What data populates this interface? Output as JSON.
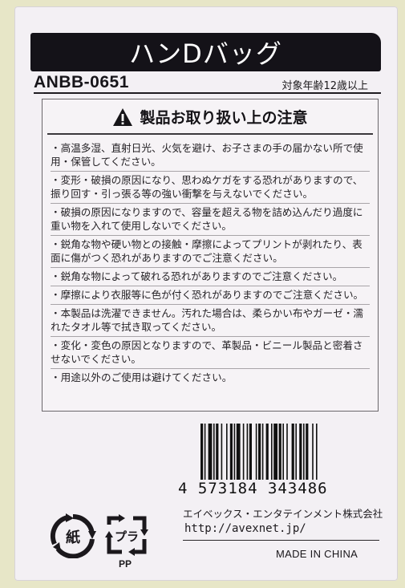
{
  "header": {
    "title": "ハンDバッグ"
  },
  "product_code": "ANBB-0651",
  "age_notice": "対象年齢12歳以上",
  "caution": {
    "title": "製品お取り扱い上の注意",
    "items": [
      "・高温多湿、直射日光、火気を避け、お子さまの手の届かない所で使用・保管してください。",
      "・変形・破損の原因になり、思わぬケガをする恐れがありますので、振り回す・引っ張る等の強い衝撃を与えないでください。",
      "・破損の原因になりますので、容量を超える物を詰め込んだり過度に重い物を入れて使用しないでください。",
      "・鋭角な物や硬い物との接触・摩擦によってプリントが剥れたり、表面に傷がつく恐れがありますのでご注意ください。",
      "・鋭角な物によって破れる恐れがありますのでご注意ください。",
      "・摩擦により衣服等に色が付く恐れがありますのでご注意ください。",
      "・本製品は洗濯できません。汚れた場合は、柔らかい布やガーゼ・濡れたタオル等で拭き取ってください。",
      "・変化・変色の原因となりますので、革製品・ビニール製品と密着させないでください。",
      "・用途以外のご使用は避けてください。"
    ]
  },
  "barcode": {
    "number": "4 573184 343486"
  },
  "company": {
    "name": "エイベックス・エンタテインメント株式会社",
    "url": "http://avexnet.jp/"
  },
  "origin": "MADE IN CHINA",
  "recycle": {
    "paper_mark": "紙",
    "plastic_mark": "プラ",
    "plastic_material": "PP"
  },
  "icons": {
    "warning": "warning-triangle-icon",
    "paper": "paper-recycle-icon",
    "plastic": "plastic-recycle-icon"
  }
}
